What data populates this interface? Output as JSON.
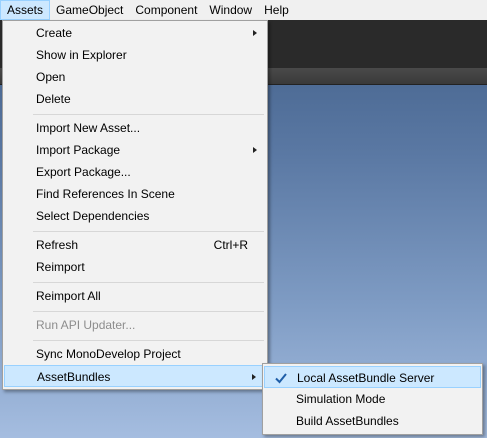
{
  "menubar": {
    "items": [
      "Assets",
      "GameObject",
      "Component",
      "Window",
      "Help"
    ],
    "active": "Assets"
  },
  "assets_menu": {
    "items": [
      {
        "label": "Create",
        "submenu": true
      },
      {
        "label": "Show in Explorer"
      },
      {
        "label": "Open"
      },
      {
        "label": "Delete"
      },
      {
        "label": "Import New Asset..."
      },
      {
        "label": "Import Package",
        "submenu": true
      },
      {
        "label": "Export Package..."
      },
      {
        "label": "Find References In Scene"
      },
      {
        "label": "Select Dependencies"
      },
      {
        "label": "Refresh",
        "shortcut": "Ctrl+R"
      },
      {
        "label": "Reimport"
      },
      {
        "label": "Reimport All"
      },
      {
        "label": "Run API Updater...",
        "disabled": true
      },
      {
        "label": "Sync MonoDevelop Project"
      },
      {
        "label": "AssetBundles",
        "submenu": true,
        "highlighted": true
      }
    ]
  },
  "assetbundles_submenu": {
    "items": [
      {
        "label": "Local AssetBundle Server",
        "checked": true,
        "highlighted": true
      },
      {
        "label": "Simulation Mode"
      },
      {
        "label": "Build AssetBundles"
      }
    ]
  },
  "colors": {
    "highlight_bg": "#cce8ff",
    "highlight_border": "#99d1ff",
    "check": "#1f5ea8"
  }
}
